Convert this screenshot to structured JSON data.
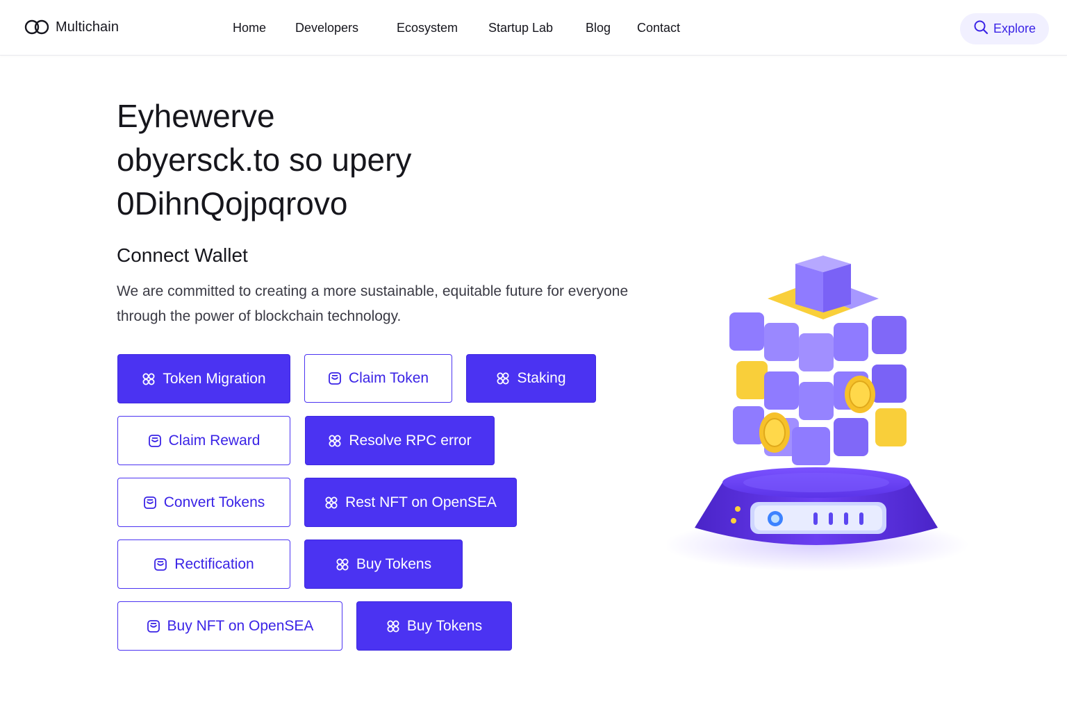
{
  "brand": {
    "name": "Multichain",
    "logo_icon": "infinity-rings-icon"
  },
  "nav": {
    "items": [
      {
        "label": "Home"
      },
      {
        "label": "Developers"
      },
      {
        "label": "Ecosystem"
      },
      {
        "label": "Startup Lab"
      },
      {
        "label": "Blog"
      },
      {
        "label": "Contact"
      }
    ],
    "explore": {
      "label": "Explore",
      "icon": "search-icon"
    }
  },
  "hero": {
    "title_lines": [
      "Eyhewerve",
      "obyersck.to so upery",
      "0DihnQojpqrovo"
    ],
    "section_title": "Connect Wallet",
    "description": "We are committed to creating a more sustainable, equitable future for everyone through the power of blockchain technology."
  },
  "actions": [
    {
      "label": "Token Migration",
      "style": "solid",
      "icon": "clover-icon"
    },
    {
      "label": "Claim Token",
      "style": "outline",
      "icon": "wallet-icon"
    },
    {
      "label": "Staking",
      "style": "solid",
      "icon": "clover-icon"
    },
    {
      "label": "Claim Reward",
      "style": "outline",
      "icon": "wallet-icon"
    },
    {
      "label": "Resolve RPC error",
      "style": "solid",
      "icon": "clover-icon"
    },
    {
      "label": "Convert Tokens",
      "style": "outline",
      "icon": "wallet-icon"
    },
    {
      "label": "Rest NFT on OpenSEA",
      "style": "solid",
      "icon": "clover-icon"
    },
    {
      "label": "Rectification",
      "style": "outline",
      "icon": "wallet-icon"
    },
    {
      "label": "Buy Tokens",
      "style": "solid",
      "icon": "clover-icon"
    },
    {
      "label": "Buy NFT on OpenSEA",
      "style": "outline",
      "icon": "wallet-icon"
    },
    {
      "label": "Buy Tokens",
      "style": "solid",
      "icon": "clover-icon"
    }
  ],
  "illustration": {
    "name": "cube-on-pedestal-illustration"
  },
  "colors": {
    "accent": "#4b33f2",
    "accent_text": "#3a23e6",
    "explore_bg": "#f1f0ff",
    "cube_purple": "#8f7bff",
    "cube_yellow": "#f9cf3a",
    "pedestal": "#5a35e6"
  }
}
